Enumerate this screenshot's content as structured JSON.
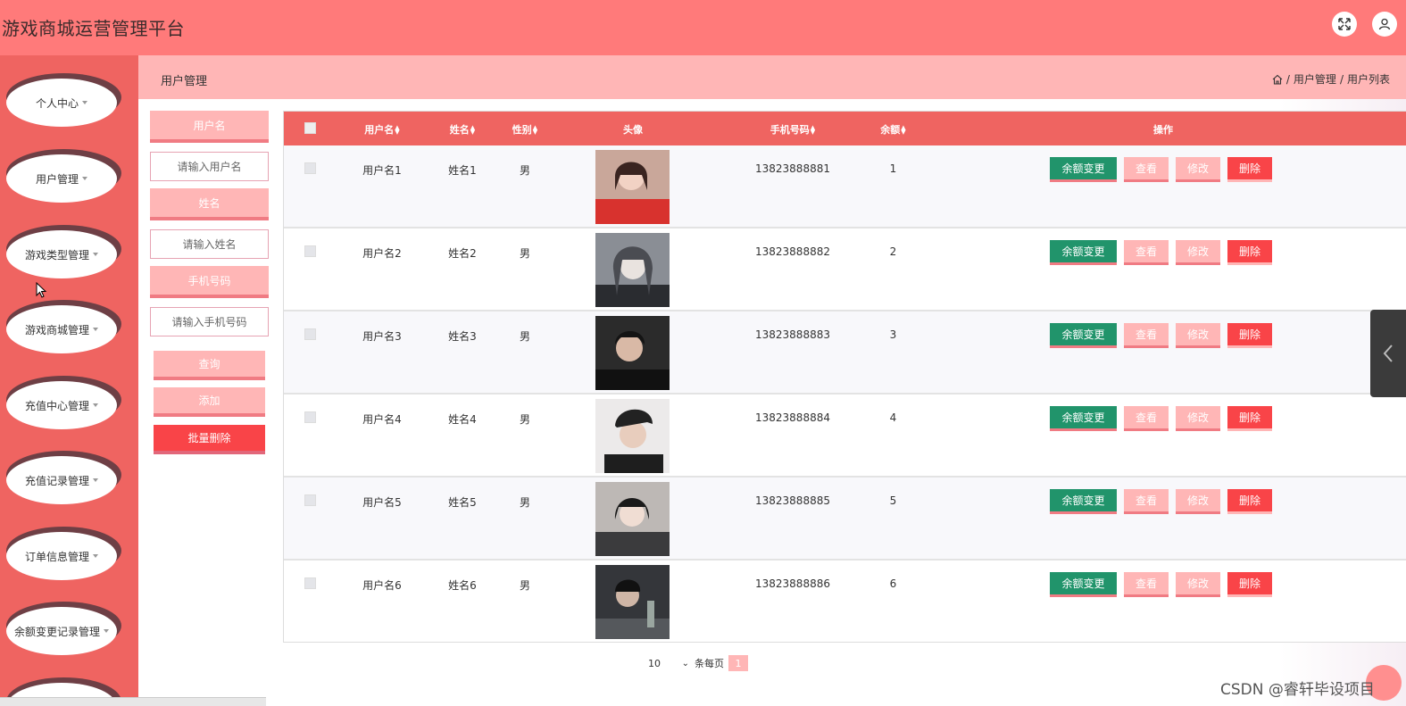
{
  "header": {
    "title": "游戏商城运营管理平台"
  },
  "sidebar": {
    "items": [
      {
        "label": "个人中心"
      },
      {
        "label": "用户管理"
      },
      {
        "label": "游戏类型管理"
      },
      {
        "label": "游戏商城管理"
      },
      {
        "label": "充值中心管理"
      },
      {
        "label": "充值记录管理"
      },
      {
        "label": "订单信息管理"
      },
      {
        "label": "余额变更记录管理"
      }
    ]
  },
  "breadcrumb": {
    "page_title": "用户管理",
    "path": "用户管理",
    "current": "用户列表",
    "separator": "/"
  },
  "filter": {
    "username_label": "用户名",
    "username_placeholder": "请输入用户名",
    "name_label": "姓名",
    "name_placeholder": "请输入姓名",
    "phone_label": "手机号码",
    "phone_placeholder": "请输入手机号码",
    "query": "查询",
    "add": "添加",
    "batch_delete": "批量删除"
  },
  "table": {
    "columns": {
      "username": "用户名",
      "name": "姓名",
      "gender": "性别",
      "avatar": "头像",
      "phone": "手机号码",
      "balance": "余额",
      "actions": "操作"
    },
    "action_labels": {
      "change": "余额变更",
      "view": "查看",
      "edit": "修改",
      "delete": "删除"
    },
    "rows": [
      {
        "username": "用户名1",
        "name": "姓名1",
        "gender": "男",
        "phone": "13823888881",
        "balance": "1"
      },
      {
        "username": "用户名2",
        "name": "姓名2",
        "gender": "男",
        "phone": "13823888882",
        "balance": "2"
      },
      {
        "username": "用户名3",
        "name": "姓名3",
        "gender": "男",
        "phone": "13823888883",
        "balance": "3"
      },
      {
        "username": "用户名4",
        "name": "姓名4",
        "gender": "男",
        "phone": "13823888884",
        "balance": "4"
      },
      {
        "username": "用户名5",
        "name": "姓名5",
        "gender": "男",
        "phone": "13823888885",
        "balance": "5"
      },
      {
        "username": "用户名6",
        "name": "姓名6",
        "gender": "男",
        "phone": "13823888886",
        "balance": "6"
      }
    ]
  },
  "pagination": {
    "page_size": "10",
    "per_page_label": "条每页",
    "current_page": "1"
  },
  "watermark": "CSDN @睿轩毕设项目"
}
